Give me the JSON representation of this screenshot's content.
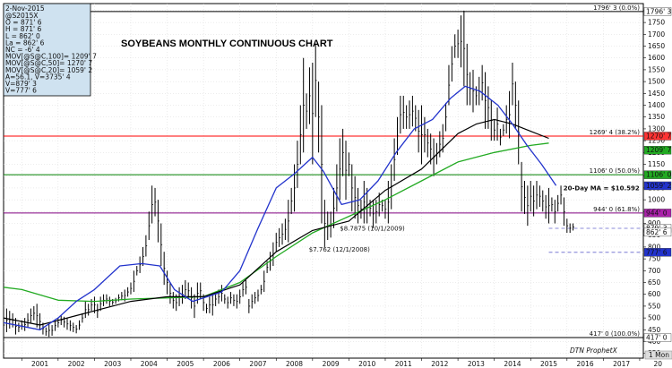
{
  "info_panel": {
    "date": "2-Nov-2015",
    "lines": [
      "@S2015X",
      "O = 871' 6",
      "H = 871' 6",
      "L = 862' 0",
      "La = 862' 6",
      "NC = -6' 4",
      "MOV[@S@C,100]= 1209' 7",
      "MOV[@S@C,50]= 1270' 7",
      "MOV[@S@C,20]= 1059' 2",
      "A=56.1, V=3735' 4",
      "V=879' 3",
      "V=777' 6"
    ]
  },
  "chart_data": {
    "type": "candlestick",
    "title": "SOYBEANS MONTHLY CONTINUOUS CHART",
    "x_tick_labels": [
      "2001",
      "2002",
      "2003",
      "2004",
      "2005",
      "2006",
      "2007",
      "2008",
      "2009",
      "2010",
      "2011",
      "2012",
      "2013",
      "2014",
      "2015",
      "2016",
      "2017",
      "20"
    ],
    "y_tick_labels": [
      "350",
      "400",
      "450",
      "500",
      "550",
      "600",
      "650",
      "700",
      "750",
      "800",
      "850",
      "900",
      "950",
      "1000",
      "1050",
      "1100",
      "1150",
      "1200",
      "1250",
      "1300",
      "1350",
      "1400",
      "1450",
      "1500",
      "1550",
      "1600",
      "1650",
      "1700",
      "1750",
      "1800"
    ],
    "ylim": [
      330,
      1830
    ],
    "bars_start": [
      2000,
      0.5
    ],
    "bars_hl": [
      [
        520,
        420
      ],
      [
        540,
        440
      ],
      [
        530,
        455
      ],
      [
        520,
        460
      ],
      [
        500,
        430
      ],
      [
        480,
        440
      ],
      [
        490,
        450
      ],
      [
        500,
        445
      ],
      [
        520,
        460
      ],
      [
        540,
        480
      ],
      [
        550,
        490
      ],
      [
        560,
        460
      ],
      [
        520,
        450
      ],
      [
        480,
        430
      ],
      [
        460,
        425
      ],
      [
        475,
        420
      ],
      [
        470,
        425
      ],
      [
        490,
        445
      ],
      [
        500,
        460
      ],
      [
        510,
        470
      ],
      [
        505,
        460
      ],
      [
        500,
        450
      ],
      [
        490,
        445
      ],
      [
        480,
        440
      ],
      [
        470,
        435
      ],
      [
        490,
        450
      ],
      [
        520,
        480
      ],
      [
        570,
        500
      ],
      [
        560,
        510
      ],
      [
        580,
        530
      ],
      [
        590,
        520
      ],
      [
        560,
        500
      ],
      [
        590,
        530
      ],
      [
        600,
        550
      ],
      [
        600,
        560
      ],
      [
        590,
        550
      ],
      [
        580,
        555
      ],
      [
        585,
        560
      ],
      [
        600,
        570
      ],
      [
        610,
        575
      ],
      [
        620,
        570
      ],
      [
        630,
        590
      ],
      [
        650,
        600
      ],
      [
        700,
        610
      ],
      [
        720,
        680
      ],
      [
        760,
        690
      ],
      [
        800,
        720
      ],
      [
        850,
        760
      ],
      [
        950,
        830
      ],
      [
        1060,
        900
      ],
      [
        1050,
        930
      ],
      [
        1000,
        820
      ],
      [
        900,
        720
      ],
      [
        780,
        640
      ],
      [
        700,
        600
      ],
      [
        650,
        560
      ],
      [
        610,
        540
      ],
      [
        600,
        530
      ],
      [
        630,
        550
      ],
      [
        640,
        560
      ],
      [
        660,
        580
      ],
      [
        650,
        580
      ],
      [
        630,
        540
      ],
      [
        600,
        500
      ],
      [
        650,
        560
      ],
      [
        650,
        580
      ],
      [
        600,
        530
      ],
      [
        560,
        520
      ],
      [
        590,
        520
      ],
      [
        600,
        510
      ],
      [
        610,
        550
      ],
      [
        620,
        560
      ],
      [
        640,
        570
      ],
      [
        600,
        560
      ],
      [
        590,
        540
      ],
      [
        610,
        560
      ],
      [
        600,
        550
      ],
      [
        600,
        540
      ],
      [
        620,
        560
      ],
      [
        650,
        590
      ],
      [
        660,
        600
      ],
      [
        580,
        520
      ],
      [
        600,
        540
      ],
      [
        610,
        560
      ],
      [
        620,
        570
      ],
      [
        640,
        600
      ],
      [
        700,
        610
      ],
      [
        740,
        690
      ],
      [
        780,
        700
      ],
      [
        820,
        720
      ],
      [
        860,
        780
      ],
      [
        880,
        800
      ],
      [
        900,
        810
      ],
      [
        920,
        830
      ],
      [
        1000,
        820
      ],
      [
        1050,
        940
      ],
      [
        1150,
        950
      ],
      [
        1250,
        1050
      ],
      [
        1400,
        1150
      ],
      [
        1600,
        1200
      ],
      [
        1450,
        1300
      ],
      [
        1560,
        1320
      ],
      [
        1580,
        1150
      ],
      [
        1660,
        1350
      ],
      [
        1500,
        1200
      ],
      [
        1400,
        900
      ],
      [
        1000,
        800
      ],
      [
        950,
        830
      ],
      [
        950,
        840
      ],
      [
        1050,
        880
      ],
      [
        1150,
        950
      ],
      [
        1260,
        1000
      ],
      [
        1300,
        1100
      ],
      [
        1250,
        1000
      ],
      [
        1200,
        1100
      ],
      [
        1150,
        950
      ],
      [
        1100,
        920
      ],
      [
        1050,
        900
      ],
      [
        1000,
        920
      ],
      [
        1080,
        900
      ],
      [
        1050,
        900
      ],
      [
        1000,
        930
      ],
      [
        1000,
        880
      ],
      [
        1000,
        900
      ],
      [
        1030,
        930
      ],
      [
        1000,
        950
      ],
      [
        1000,
        920
      ],
      [
        1080,
        900
      ],
      [
        1150,
        960
      ],
      [
        1260,
        1080
      ],
      [
        1350,
        1190
      ],
      [
        1440,
        1280
      ],
      [
        1440,
        1300
      ],
      [
        1400,
        1300
      ],
      [
        1420,
        1300
      ],
      [
        1440,
        1310
      ],
      [
        1400,
        1290
      ],
      [
        1380,
        1200
      ],
      [
        1400,
        1150
      ],
      [
        1350,
        1200
      ],
      [
        1300,
        1180
      ],
      [
        1280,
        1150
      ],
      [
        1260,
        1100
      ],
      [
        1240,
        1150
      ],
      [
        1290,
        1180
      ],
      [
        1320,
        1200
      ],
      [
        1410,
        1290
      ],
      [
        1570,
        1400
      ],
      [
        1650,
        1500
      ],
      [
        1700,
        1600
      ],
      [
        1720,
        1600
      ],
      [
        1780,
        1560
      ],
      [
        1800,
        1480
      ],
      [
        1660,
        1400
      ],
      [
        1540,
        1400
      ],
      [
        1550,
        1370
      ],
      [
        1480,
        1400
      ],
      [
        1520,
        1400
      ],
      [
        1570,
        1420
      ],
      [
        1540,
        1300
      ],
      [
        1480,
        1300
      ],
      [
        1420,
        1250
      ],
      [
        1340,
        1250
      ],
      [
        1390,
        1250
      ],
      [
        1300,
        1230
      ],
      [
        1320,
        1270
      ],
      [
        1400,
        1280
      ],
      [
        1460,
        1260
      ],
      [
        1580,
        1400
      ],
      [
        1500,
        1300
      ],
      [
        1420,
        1150
      ],
      [
        1160,
        950
      ],
      [
        1080,
        940
      ],
      [
        1060,
        890
      ],
      [
        1080,
        950
      ],
      [
        1060,
        930
      ],
      [
        1080,
        960
      ],
      [
        1060,
        970
      ],
      [
        1040,
        950
      ],
      [
        1020,
        920
      ],
      [
        1050,
        900
      ],
      [
        1010,
        950
      ],
      [
        1000,
        900
      ],
      [
        1020,
        950
      ],
      [
        1060,
        980
      ],
      [
        1010,
        890
      ],
      [
        920,
        860
      ],
      [
        900,
        860
      ],
      [
        900,
        870
      ]
    ],
    "sma100_keys": [
      [
        2000.5,
        630
      ],
      [
        2001,
        620
      ],
      [
        2002,
        575
      ],
      [
        2003,
        570
      ],
      [
        2004,
        580
      ],
      [
        2005,
        585
      ],
      [
        2006,
        590
      ],
      [
        2007,
        650
      ],
      [
        2008,
        760
      ],
      [
        2009,
        860
      ],
      [
        2010,
        930
      ],
      [
        2011,
        1000
      ],
      [
        2012,
        1080
      ],
      [
        2013,
        1160
      ],
      [
        2014,
        1200
      ],
      [
        2015,
        1230
      ],
      [
        2015.5,
        1240
      ]
    ],
    "sma50_keys": [
      [
        2000.5,
        500
      ],
      [
        2001.5,
        470
      ],
      [
        2002,
        490
      ],
      [
        2002.5,
        510
      ],
      [
        2003,
        530
      ],
      [
        2004,
        570
      ],
      [
        2005,
        590
      ],
      [
        2006,
        590
      ],
      [
        2007,
        640
      ],
      [
        2008,
        780
      ],
      [
        2009,
        870
      ],
      [
        2010,
        910
      ],
      [
        2011,
        1040
      ],
      [
        2012,
        1130
      ],
      [
        2013,
        1280
      ],
      [
        2013.5,
        1320
      ],
      [
        2014,
        1340
      ],
      [
        2014.5,
        1320
      ],
      [
        2015,
        1290
      ],
      [
        2015.5,
        1260
      ]
    ],
    "sma20_keys": [
      [
        2000.5,
        480
      ],
      [
        2001.5,
        450
      ],
      [
        2002,
        500
      ],
      [
        2002.5,
        570
      ],
      [
        2003,
        620
      ],
      [
        2003.7,
        720
      ],
      [
        2004.3,
        730
      ],
      [
        2004.8,
        720
      ],
      [
        2005.2,
        620
      ],
      [
        2005.7,
        570
      ],
      [
        2006.5,
        610
      ],
      [
        2007,
        700
      ],
      [
        2007.5,
        880
      ],
      [
        2008,
        1050
      ],
      [
        2008.5,
        1110
      ],
      [
        2009,
        1180
      ],
      [
        2009.3,
        1120
      ],
      [
        2009.8,
        980
      ],
      [
        2010.3,
        1000
      ],
      [
        2010.8,
        1080
      ],
      [
        2011.3,
        1200
      ],
      [
        2011.8,
        1300
      ],
      [
        2012.3,
        1340
      ],
      [
        2012.8,
        1430
      ],
      [
        2013.2,
        1480
      ],
      [
        2013.6,
        1460
      ],
      [
        2014.1,
        1400
      ],
      [
        2014.5,
        1320
      ],
      [
        2014.9,
        1230
      ],
      [
        2015.3,
        1150
      ],
      [
        2015.7,
        1060
      ]
    ],
    "hlines": [
      {
        "label": "1796' 3 (0.0%)",
        "value": 1796.375,
        "color": "#000000",
        "box": "1796' 3"
      },
      {
        "label": "1269' 4 (38.2%)",
        "value": 1269.5,
        "color": "#ff0000",
        "box": "1270' 7"
      },
      {
        "label": "1106' 0 (50.0%)",
        "value": 1106.0,
        "color": "#008000",
        "box": "1106' 0"
      },
      {
        "label": "944' 0 (61.8%)",
        "value": 944.0,
        "color": "#800080",
        "box": "944' 0"
      },
      {
        "label": "417' 0 (100.0%)",
        "value": 417.0,
        "color": "#000000",
        "box": "417' 0"
      }
    ],
    "right_boxes": [
      {
        "text": "1209' 7",
        "value": 1209.875,
        "bg": "#22aa22"
      },
      {
        "text": "1059' 2",
        "value": 1059.25,
        "bg": "#2233cc"
      },
      {
        "text": "879' 3",
        "value": 879.375,
        "bg": "#ffffff"
      },
      {
        "text": "862' 6",
        "value": 862.75,
        "bg": "#ffffff"
      },
      {
        "text": "777' 6",
        "value": 777.75,
        "bg": "#2233cc"
      }
    ],
    "dashed_lines": [
      {
        "value": 879.375,
        "color": "#6666cc"
      },
      {
        "value": 777.75,
        "color": "#6666cc"
      }
    ],
    "annotations": [
      {
        "text": "$8.7875 (10/1/2009)",
        "x": 2009.75,
        "y": 870
      },
      {
        "text": "$7.762 (12/1/2008)",
        "x": 2008.9,
        "y": 780
      },
      {
        "text": "20-Day MA = $10.592",
        "x": 2015.9,
        "y": 1040
      }
    ],
    "footer_label": "DTN ProphetX",
    "period_label": "1 Mon",
    "colors": {
      "sma100": "#22aa22",
      "sma50": "#000000",
      "sma20": "#2233cc",
      "bars": "#000000",
      "panel_bg": "#cfe2f0"
    }
  }
}
